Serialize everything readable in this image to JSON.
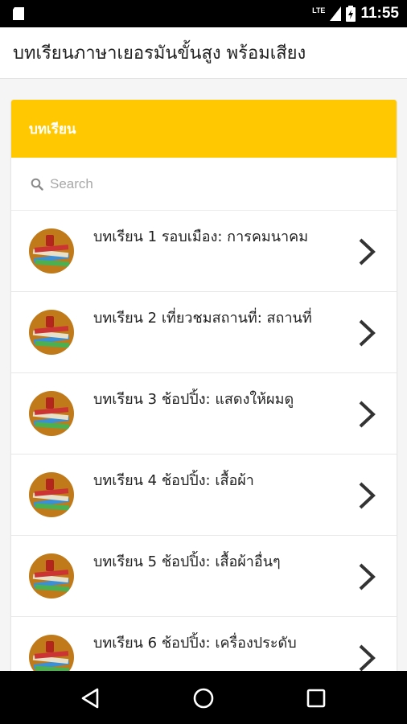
{
  "status_bar": {
    "time": "11:55",
    "network": "LTE"
  },
  "app_bar": {
    "title": "บทเรียนภาษาเยอรมันขั้นสูง พร้อมเสียง"
  },
  "card": {
    "header": "บทเรียน",
    "search": {
      "placeholder": "Search",
      "value": "",
      "icon": "search-icon"
    },
    "lessons": [
      {
        "label": "บทเรียน 1 รอบเมือง: การคมนาคม"
      },
      {
        "label": "บทเรียน 2 เที่ยวชมสถานที่: สถานที่"
      },
      {
        "label": "บทเรียน 3 ช้อปปิ้ง: แสดงให้ผมดู"
      },
      {
        "label": "บทเรียน 4 ช้อปปิ้ง: เสื้อผ้า"
      },
      {
        "label": "บทเรียน 5 ช้อปปิ้ง: เสื้อผ้าอื่นๆ"
      },
      {
        "label": "บทเรียน 6 ช้อปปิ้ง: เครื่องประดับ"
      }
    ]
  },
  "navigation": {
    "back": "back-icon",
    "home": "home-icon",
    "recents": "recents-icon"
  },
  "colors": {
    "accent": "#ffc800",
    "thumb_bg": "#c07a1a",
    "background": "#f5f5f5"
  }
}
